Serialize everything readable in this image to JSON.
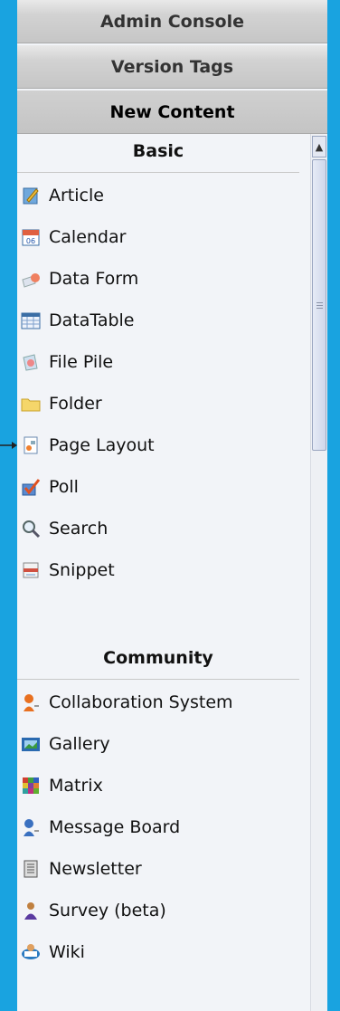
{
  "header": {
    "admin_console": "Admin Console",
    "version_tags": "Version Tags",
    "new_content": "New Content"
  },
  "sections": {
    "basic": {
      "title": "Basic",
      "items": [
        {
          "label": "Article",
          "icon": "article-icon"
        },
        {
          "label": "Calendar",
          "icon": "calendar-icon"
        },
        {
          "label": "Data Form",
          "icon": "data-form-icon"
        },
        {
          "label": "DataTable",
          "icon": "datatable-icon"
        },
        {
          "label": "File Pile",
          "icon": "file-pile-icon"
        },
        {
          "label": "Folder",
          "icon": "folder-icon"
        },
        {
          "label": "Page Layout",
          "icon": "page-layout-icon"
        },
        {
          "label": "Poll",
          "icon": "poll-icon"
        },
        {
          "label": "Search",
          "icon": "search-icon"
        },
        {
          "label": "Snippet",
          "icon": "snippet-icon"
        }
      ]
    },
    "community": {
      "title": "Community",
      "items": [
        {
          "label": "Collaboration System",
          "icon": "collaboration-icon"
        },
        {
          "label": "Gallery",
          "icon": "gallery-icon"
        },
        {
          "label": "Matrix",
          "icon": "matrix-icon"
        },
        {
          "label": "Message Board",
          "icon": "message-board-icon"
        },
        {
          "label": "Newsletter",
          "icon": "newsletter-icon"
        },
        {
          "label": "Survey (beta)",
          "icon": "survey-icon"
        },
        {
          "label": "Wiki",
          "icon": "wiki-icon"
        }
      ]
    }
  },
  "calendar_icon_text": "06",
  "colors": {
    "background": "#19a3e0",
    "panel": "#f2f4f8"
  }
}
